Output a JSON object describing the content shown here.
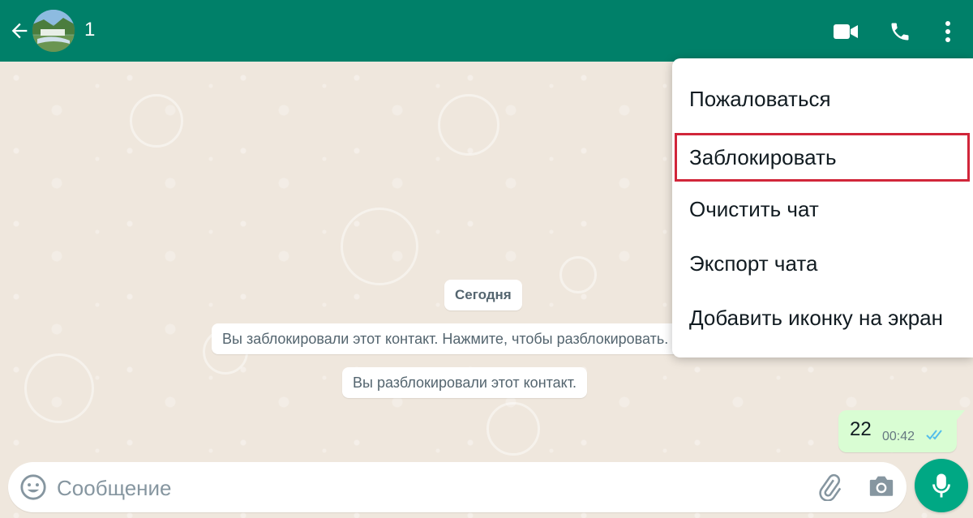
{
  "header": {
    "contact_name": "1",
    "background_color": "#008069",
    "icons": [
      "arrow-left-icon",
      "video-camera-icon",
      "phone-icon",
      "more-vertical-icon"
    ]
  },
  "chat": {
    "date_label": "Сегодня",
    "system_messages": [
      "Вы заблокировали этот контакт. Нажмите, чтобы разблокировать.",
      "Вы разблокировали этот контакт."
    ],
    "outgoing_message": {
      "text": "22",
      "time": "00:42",
      "status_icon": "double-check-icon"
    }
  },
  "input_bar": {
    "placeholder": "Сообщение",
    "icons": [
      "emoji-icon",
      "paperclip-icon",
      "camera-icon",
      "microphone-icon"
    ],
    "mic_color": "#00a884"
  },
  "menu": {
    "items": [
      {
        "label": "Пожаловаться",
        "highlighted": false
      },
      {
        "label": "Заблокировать",
        "highlighted": true
      },
      {
        "label": "Очистить чат",
        "highlighted": false
      },
      {
        "label": "Экспорт чата",
        "highlighted": false
      },
      {
        "label": "Добавить иконку на экран",
        "highlighted": false
      }
    ],
    "highlight_color": "#d1263a"
  }
}
